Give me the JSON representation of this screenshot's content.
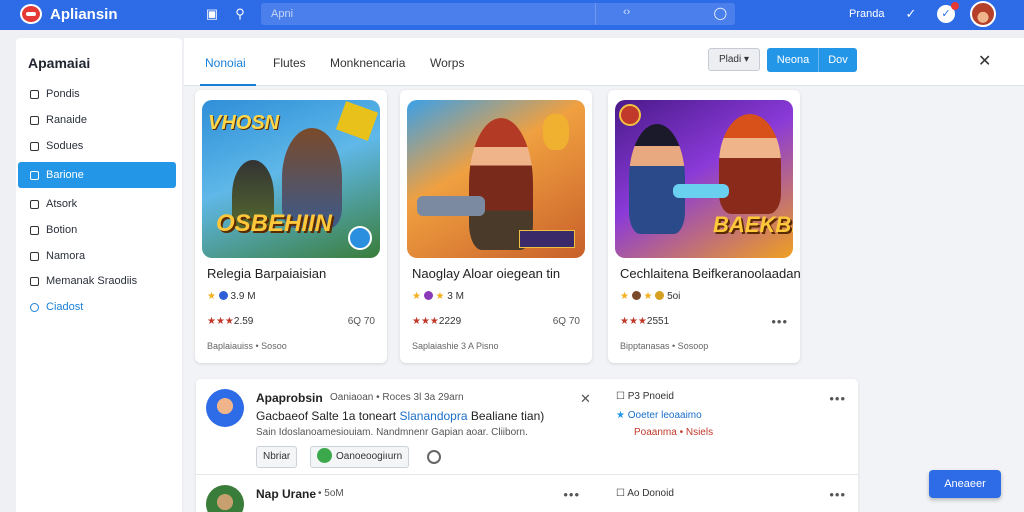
{
  "app": {
    "title": "Apliansin"
  },
  "topbar": {
    "search_placeholder": "Apni",
    "right_text": "Pranda",
    "notification_count": ""
  },
  "sidebar": {
    "title": "Apamaiai",
    "items": [
      {
        "label": "Pondis"
      },
      {
        "label": "Ranaide"
      },
      {
        "label": "Sodues"
      },
      {
        "label": "Barione"
      },
      {
        "label": "Atsork"
      },
      {
        "label": "Botion"
      },
      {
        "label": "Namora"
      },
      {
        "label": "Memanak Sraodiis"
      },
      {
        "label": "Ciadost"
      }
    ]
  },
  "tabs": [
    {
      "label": "Nonoiai"
    },
    {
      "label": "Flutes"
    },
    {
      "label": "Monknencaria"
    },
    {
      "label": "Worps"
    }
  ],
  "toolbar": {
    "filter_label": "Pladi",
    "primary_left": "Neona",
    "primary_right": "Dov"
  },
  "cards": [
    {
      "art_top": "VHOSN",
      "art_bottom": "OSBEHIIN",
      "title": "Relegia Barpaiaisian",
      "rating_text": "3.9 M",
      "stats": "2.59",
      "meta": "6Q 70",
      "subline": "Baplaiauiss • Sosoo"
    },
    {
      "art_top": "",
      "art_bottom": "",
      "title": "Naoglay Aloar oiegean tin",
      "rating_text": "3 M",
      "stats": "2229",
      "meta": "6Q 70",
      "subline": "Saplaiashie 3 A Pisno"
    },
    {
      "art_top": "",
      "art_bottom": "BAEKBIO",
      "title": "Cechlaitena Beifkeranoolaadan",
      "rating_text": "5oi",
      "stats": "2551",
      "meta": "",
      "subline": "Bipptanasas • Sosoop"
    }
  ],
  "feed": {
    "post1": {
      "name": "Apaprobsin",
      "meta": "Oaniaoan • Roces 3l 3a 29arn",
      "heading_a": "Gacbaeof Salte 1a toneart",
      "heading_b": "Slanandopra",
      "heading_c": "Bealiane tian)",
      "body": "Sain Idoslanoamesiouiam. Nandmnenr Gapian aoar. Cliiborn.",
      "chip1": "Nbriar",
      "chip2": "Oanoeoogiıurn",
      "side1": "P3 Pnoeid",
      "side2": "Ooeter leoaaimo",
      "side3": "Poaanma • Nsiels"
    },
    "post2": {
      "name": "Nap Urane",
      "meta": "• 5oM",
      "side1": "Ao Donoid"
    }
  },
  "float_button": "Aneaeer",
  "colors": {
    "topbar": "#2e6be6",
    "accent": "#2396e8",
    "active_tab": "#1a7fd6"
  }
}
